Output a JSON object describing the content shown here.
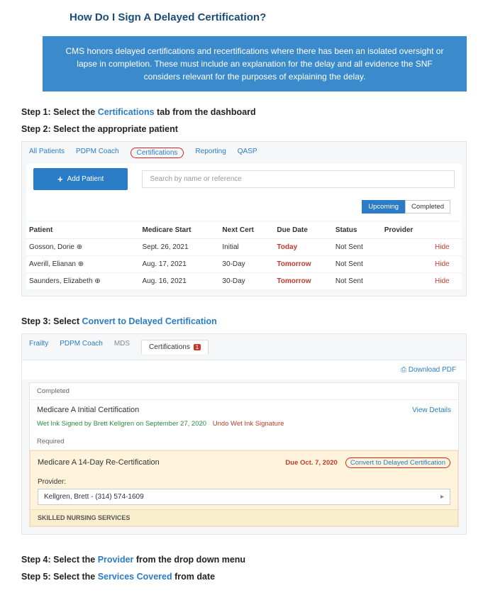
{
  "title": "How Do I Sign A Delayed Certification?",
  "callout": "CMS honors delayed certifications and recertifications where there has been an isolated oversight or lapse in completion. These must include an explanation for the delay and all evidence the SNF considers relevant for the purposes of explaining the delay.",
  "step1": {
    "prefix": "Step 1: Select the ",
    "link": "Certifications",
    "suffix": " tab from the dashboard"
  },
  "step2": {
    "text": "Step 2: Select the appropriate patient"
  },
  "step3": {
    "prefix": "Step 3: Select ",
    "link": "Convert to Delayed Certification"
  },
  "step4": {
    "prefix": "Step 4: Select the ",
    "link": "Provider",
    "suffix": " from the drop down menu"
  },
  "step5": {
    "prefix": "Step 5: Select the ",
    "link": "Services Covered",
    "suffix": " from date"
  },
  "shot1": {
    "tabs": {
      "all": "All Patients",
      "pdpm": "PDPM Coach",
      "cert": "Certifications",
      "report": "Reporting",
      "qasp": "QASP"
    },
    "addBtn": "Add Patient",
    "searchPh": "Search by name or reference",
    "pills": {
      "upcoming": "Upcoming",
      "completed": "Completed"
    },
    "headers": {
      "patient": "Patient",
      "medstart": "Medicare Start",
      "nextcert": "Next Cert",
      "duedate": "Due Date",
      "status": "Status",
      "provider": "Provider"
    },
    "rows": [
      {
        "patient": "Gosson, Dorie  ⊕",
        "medstart": "Sept. 26, 2021",
        "nextcert": "Initial",
        "duedate": "Today",
        "status": "Not Sent",
        "action": "Hide"
      },
      {
        "patient": "Averill, Elianan  ⊕",
        "medstart": "Aug. 17, 2021",
        "nextcert": "30-Day",
        "duedate": "Tomorrow",
        "status": "Not Sent",
        "action": "Hide"
      },
      {
        "patient": "Saunders, Elizabeth  ⊕",
        "medstart": "Aug. 16, 2021",
        "nextcert": "30-Day",
        "duedate": "Tomorrow",
        "status": "Not Sent",
        "action": "Hide"
      }
    ]
  },
  "shot2": {
    "tabs": {
      "frailty": "Frailty",
      "pdpm": "PDPM Coach",
      "mds": "MDS",
      "cert": "Certifications",
      "badge": "1"
    },
    "download": "Download PDF",
    "completed": "Completed",
    "certTitle": "Medicare A Initial Certification",
    "viewDetails": "View Details",
    "signedLine": "Wet Ink Signed by Brett Kellgren on September 27, 2020",
    "undo": "Undo Wet Ink Signature",
    "required": "Required",
    "recertTitle": "Medicare A 14-Day Re-Certification",
    "dueText": "Due Oct. 7, 2020",
    "convert": "Convert to Delayed Certification",
    "providerLabel": "Provider:",
    "providerValue": "Kellgren, Brett - (314) 574-1609",
    "sns": "SKILLED NURSING SERVICES"
  }
}
